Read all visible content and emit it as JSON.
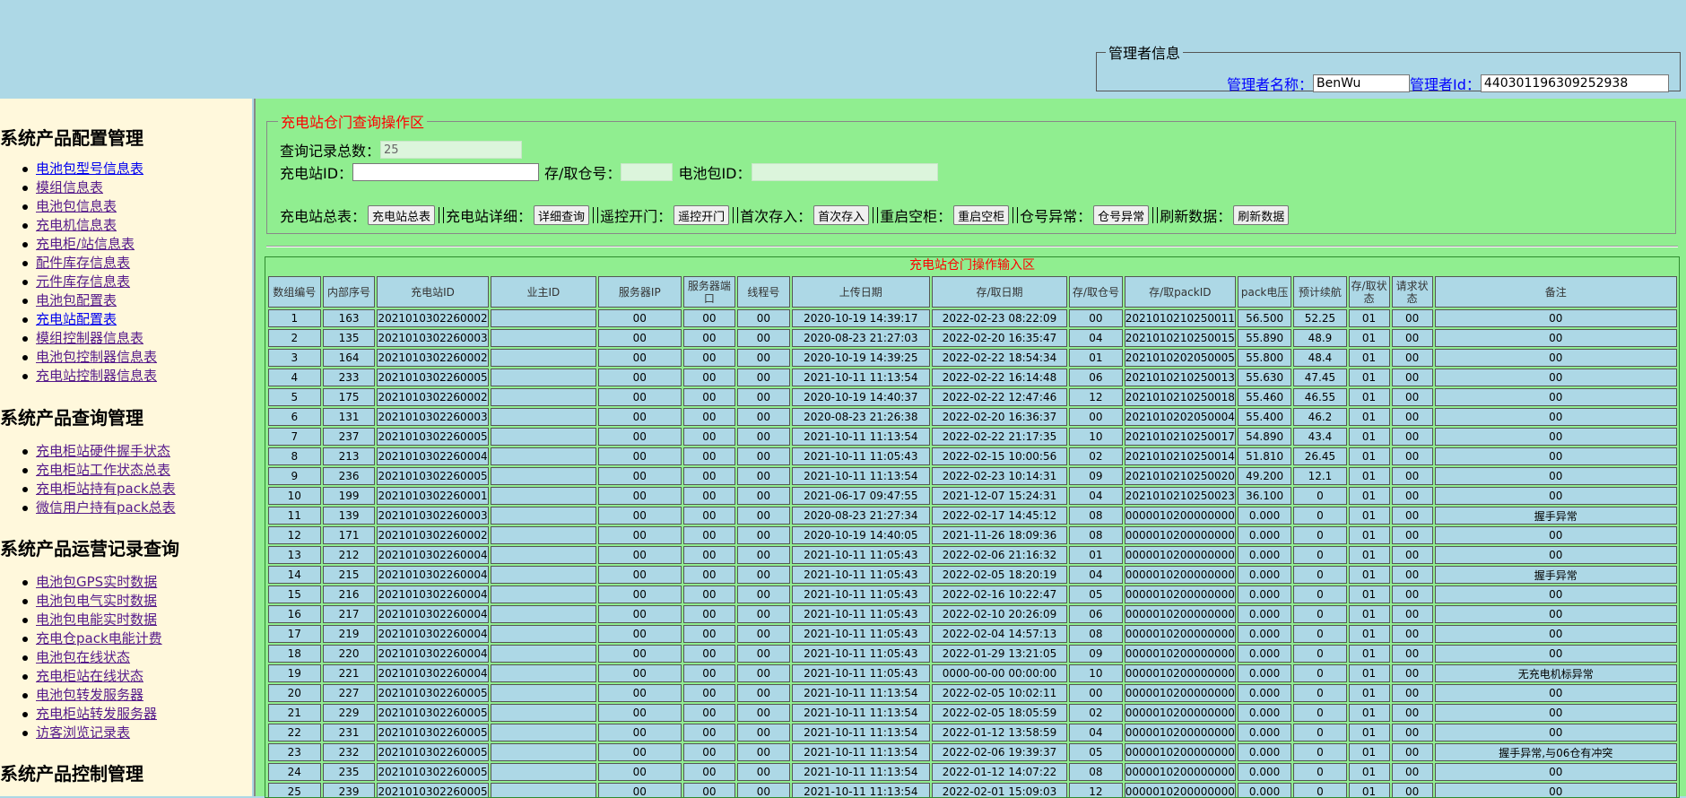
{
  "admin": {
    "legend": "管理者信息",
    "name_label": "管理者名称：",
    "name_value": "BenWu",
    "id_label": "管理者Id：",
    "id_value": "440301196309252938"
  },
  "sidebar": {
    "sections": [
      {
        "title": "系统产品配置管理",
        "items": [
          "电池包型号信息表",
          "模组信息表",
          "电池包信息表",
          "充电机信息表",
          "充电柜/站信息表",
          "配件库存信息表",
          "元件库存信息表",
          "电池包配置表",
          "充电站配置表",
          "模组控制器信息表",
          "电池包控制器信息表",
          "充电站控制器信息表"
        ]
      },
      {
        "title": "系统产品查询管理",
        "items": [
          "充电柜站硬件握手状态",
          "充电柜站工作状态总表",
          "充电柜站持有pack总表",
          "微信用户持有pack总表"
        ]
      },
      {
        "title": "系统产品运营记录查询",
        "items": [
          "电池包GPS实时数据",
          "电池包电气实时数据",
          "电池包电能实时数据",
          "充电仓pack电能计费",
          "电池包在线状态",
          "充电柜站在线状态",
          "电池包转发服务器",
          "充电柜站转发服务器",
          "访客浏览记录表"
        ]
      },
      {
        "title": "系统产品控制管理",
        "items": []
      }
    ]
  },
  "op": {
    "legend": "充电站仓门查询操作区",
    "total_label": "查询记录总数：",
    "total_value": "25",
    "station_label": "充电站ID：",
    "station_value": "",
    "door_label": "存/取仓号：",
    "door_value": "",
    "pack_label": "电池包ID：",
    "pack_value": "",
    "actions": [
      {
        "label": "充电站总表：",
        "button": "充电站总表"
      },
      {
        "label": "充电站详细：",
        "button": "详细查询"
      },
      {
        "label": "遥控开门：",
        "button": "遥控开门"
      },
      {
        "label": "首次存入：",
        "button": "首次存入"
      },
      {
        "label": "重启空柜：",
        "button": "重启空柜"
      },
      {
        "label": "仓号异常：",
        "button": "仓号异常"
      },
      {
        "label": "刷新数据：",
        "button": "刷新数据"
      }
    ]
  },
  "table": {
    "title": "充电站仓门操作输入区",
    "headers": [
      "数组编号",
      "内部序号",
      "充电站ID",
      "业主ID",
      "服务器IP",
      "服务器端口",
      "线程号",
      "上传日期",
      "存/取日期",
      "存/取仓号",
      "存/取packID",
      "pack电压",
      "预计续航",
      "存/取状态",
      "请求状态",
      "备注"
    ],
    "rows": [
      [
        "1",
        "163",
        "2021010302260002",
        "",
        "00",
        "00",
        "00",
        "2020-10-19 14:39:17",
        "2022-02-23 08:22:09",
        "00",
        "202101021025001​1",
        "56.500",
        "52.25",
        "01",
        "00",
        "00"
      ],
      [
        "2",
        "135",
        "2021010302260003",
        "",
        "00",
        "00",
        "00",
        "2020-08-23 21:27:03",
        "2022-02-20 16:35:47",
        "04",
        "2021010210250015",
        "55.890",
        "48.9",
        "01",
        "00",
        "00"
      ],
      [
        "3",
        "164",
        "2021010302260002",
        "",
        "00",
        "00",
        "00",
        "2020-10-19 14:39:25",
        "2022-02-22 18:54:34",
        "01",
        "2021010202050005",
        "55.800",
        "48.4",
        "01",
        "00",
        "00"
      ],
      [
        "4",
        "233",
        "2021010302260005",
        "",
        "00",
        "00",
        "00",
        "2021-10-11 11:13:54",
        "2022-02-22 16:14:48",
        "06",
        "2021010210250013",
        "55.630",
        "47.45",
        "01",
        "00",
        "00"
      ],
      [
        "5",
        "175",
        "2021010302260002",
        "",
        "00",
        "00",
        "00",
        "2020-10-19 14:40:37",
        "2022-02-22 12:47:46",
        "12",
        "2021010210250018",
        "55.460",
        "46.55",
        "01",
        "00",
        "00"
      ],
      [
        "6",
        "131",
        "2021010302260003",
        "",
        "00",
        "00",
        "00",
        "2020-08-23 21:26:38",
        "2022-02-20 16:36:37",
        "00",
        "2021010202050004",
        "55.400",
        "46.2",
        "01",
        "00",
        "00"
      ],
      [
        "7",
        "237",
        "2021010302260005",
        "",
        "00",
        "00",
        "00",
        "2021-10-11 11:13:54",
        "2022-02-22 21:17:35",
        "10",
        "2021010210250017",
        "54.890",
        "43.4",
        "01",
        "00",
        "00"
      ],
      [
        "8",
        "213",
        "2021010302260004",
        "",
        "00",
        "00",
        "00",
        "2021-10-11 11:05:43",
        "2022-02-15 10:00:56",
        "02",
        "2021010210250014",
        "51.810",
        "26.45",
        "01",
        "00",
        "00"
      ],
      [
        "9",
        "236",
        "2021010302260005",
        "",
        "00",
        "00",
        "00",
        "2021-10-11 11:13:54",
        "2022-02-23 10:14:31",
        "09",
        "2021010210250020",
        "49.200",
        "12.1",
        "01",
        "00",
        "00"
      ],
      [
        "10",
        "199",
        "2021010302260001",
        "",
        "00",
        "00",
        "00",
        "2021-06-17 09:47:55",
        "2021-12-07 15:24:31",
        "04",
        "2021010210250023",
        "36.100",
        "0",
        "01",
        "00",
        "00"
      ],
      [
        "11",
        "139",
        "2021010302260003",
        "",
        "00",
        "00",
        "00",
        "2020-08-23 21:27:34",
        "2022-02-17 14:45:12",
        "08",
        "0000010200000000",
        "0.000",
        "0",
        "01",
        "00",
        "握手异常"
      ],
      [
        "12",
        "171",
        "2021010302260002",
        "",
        "00",
        "00",
        "00",
        "2020-10-19 14:40:05",
        "2021-11-26 18:09:36",
        "08",
        "0000010200000000",
        "0.000",
        "0",
        "01",
        "00",
        "00"
      ],
      [
        "13",
        "212",
        "2021010302260004",
        "",
        "00",
        "00",
        "00",
        "2021-10-11 11:05:43",
        "2022-02-06 21:16:32",
        "01",
        "0000010200000000",
        "0.000",
        "0",
        "01",
        "00",
        "00"
      ],
      [
        "14",
        "215",
        "2021010302260004",
        "",
        "00",
        "00",
        "00",
        "2021-10-11 11:05:43",
        "2022-02-05 18:20:19",
        "04",
        "0000010200000000",
        "0.000",
        "0",
        "01",
        "00",
        "握手异常"
      ],
      [
        "15",
        "216",
        "2021010302260004",
        "",
        "00",
        "00",
        "00",
        "2021-10-11 11:05:43",
        "2022-02-16 10:22:47",
        "05",
        "0000010200000000",
        "0.000",
        "0",
        "01",
        "00",
        "00"
      ],
      [
        "16",
        "217",
        "2021010302260004",
        "",
        "00",
        "00",
        "00",
        "2021-10-11 11:05:43",
        "2022-02-10 20:26:09",
        "06",
        "0000010200000000",
        "0.000",
        "0",
        "01",
        "00",
        "00"
      ],
      [
        "17",
        "219",
        "2021010302260004",
        "",
        "00",
        "00",
        "00",
        "2021-10-11 11:05:43",
        "2022-02-04 14:57:13",
        "08",
        "0000010200000000",
        "0.000",
        "0",
        "01",
        "00",
        "00"
      ],
      [
        "18",
        "220",
        "2021010302260004",
        "",
        "00",
        "00",
        "00",
        "2021-10-11 11:05:43",
        "2022-01-29 13:21:05",
        "09",
        "0000010200000000",
        "0.000",
        "0",
        "01",
        "00",
        "00"
      ],
      [
        "19",
        "221",
        "2021010302260004",
        "",
        "00",
        "00",
        "00",
        "2021-10-11 11:05:43",
        "0000-00-00 00:00:00",
        "10",
        "0000010200000000",
        "0.000",
        "0",
        "01",
        "00",
        "无充电机标异常"
      ],
      [
        "20",
        "227",
        "2021010302260005",
        "",
        "00",
        "00",
        "00",
        "2021-10-11 11:13:54",
        "2022-02-05 10:02:11",
        "00",
        "0000010200000000",
        "0.000",
        "0",
        "01",
        "00",
        "00"
      ],
      [
        "21",
        "229",
        "2021010302260005",
        "",
        "00",
        "00",
        "00",
        "2021-10-11 11:13:54",
        "2022-02-05 18:05:59",
        "02",
        "0000010200000000",
        "0.000",
        "0",
        "01",
        "00",
        "00"
      ],
      [
        "22",
        "231",
        "2021010302260005",
        "",
        "00",
        "00",
        "00",
        "2021-10-11 11:13:54",
        "2022-01-12 13:58:59",
        "04",
        "0000010200000000",
        "0.000",
        "0",
        "01",
        "00",
        "00"
      ],
      [
        "23",
        "232",
        "2021010302260005",
        "",
        "00",
        "00",
        "00",
        "2021-10-11 11:13:54",
        "2022-02-06 19:39:37",
        "05",
        "0000010200000000",
        "0.000",
        "0",
        "01",
        "00",
        "握手异常,与06仓有冲突"
      ],
      [
        "24",
        "235",
        "2021010302260005",
        "",
        "00",
        "00",
        "00",
        "2021-10-11 11:13:54",
        "2022-01-12 14:07:22",
        "08",
        "0000010200000000",
        "0.000",
        "0",
        "01",
        "00",
        "00"
      ],
      [
        "25",
        "239",
        "2021010302260005",
        "",
        "00",
        "00",
        "00",
        "2021-10-11 11:13:54",
        "2022-02-01 15:09:03",
        "12",
        "0000010200000000",
        "0.000",
        "0",
        "01",
        "00",
        "00"
      ]
    ]
  }
}
